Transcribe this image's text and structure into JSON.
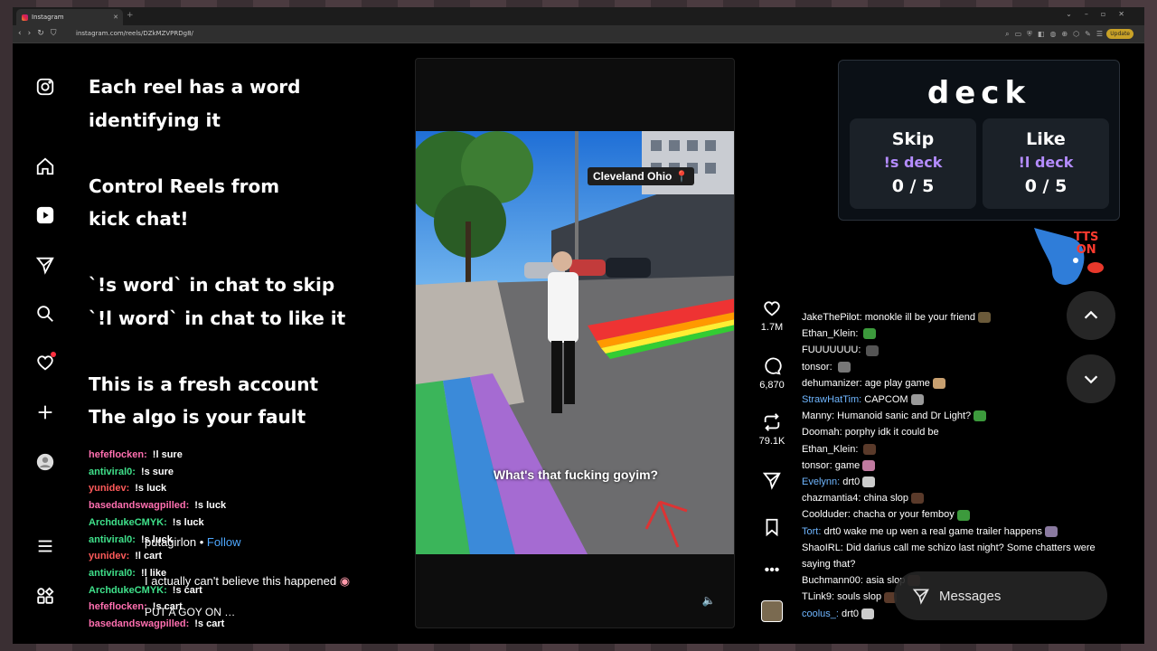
{
  "browser": {
    "tab_title": "Instagram",
    "url": "instagram.com/reels/DZkMZVPRDg8/",
    "update_label": "Update"
  },
  "overlay_text": "Each reel has a word\nidentifying it\n\nControl Reels from\nkick chat!\n\n`!s word` in chat to skip\n`!l word` in chat to like it\n\nThis is a fresh account\nThe algo is your fault",
  "left_chat": [
    {
      "user": "hefeflocken:",
      "msg": "!l sure",
      "color": "#ff6fb0"
    },
    {
      "user": "antiviral0:",
      "msg": "!s sure",
      "color": "#3fe08a"
    },
    {
      "user": "yunidev:",
      "msg": "!s luck",
      "color": "#ff5a5a"
    },
    {
      "user": "basedandswagpilled:",
      "msg": "!s luck",
      "color": "#ff6fb0"
    },
    {
      "user": "ArchdukeCMYK:",
      "msg": "!s luck",
      "color": "#3fe08a"
    },
    {
      "user": "antiviral0:",
      "msg": "!s luck",
      "color": "#3fe08a"
    },
    {
      "user": "yunidev:",
      "msg": "!l cart",
      "color": "#ff5a5a"
    },
    {
      "user": "antiviral0:",
      "msg": "!l like",
      "color": "#3fe08a"
    },
    {
      "user": "ArchdukeCMYK:",
      "msg": "!s cart",
      "color": "#3fe08a"
    },
    {
      "user": "hefeflocken:",
      "msg": "!s cart",
      "color": "#ff6fb0"
    },
    {
      "user": "basedandswagpilled:",
      "msg": "!s cart",
      "color": "#ff6fb0"
    }
  ],
  "reel": {
    "author": "putagirlon",
    "follow_label": "Follow",
    "description": "I actually can't believe this happened",
    "audio": "PUT A GOY ON",
    "location": "Cleveland Ohio",
    "caption": "What's that fucking goyim?"
  },
  "actions": {
    "likes": "1.7M",
    "comments": "6,870",
    "reposts": "79.1K"
  },
  "deck": {
    "title": "deck",
    "skip_label": "Skip",
    "skip_cmd": "!s deck",
    "skip_count": "0 / 5",
    "like_label": "Like",
    "like_cmd": "!l deck",
    "like_count": "0 / 5"
  },
  "tts": {
    "line1": "TTS",
    "line2": "ON"
  },
  "right_chat": [
    {
      "user": "JakeThePilot:",
      "msg": "monokle ill be your friend",
      "color": "#ffffff"
    },
    {
      "user": "Ethan_Klein:",
      "msg": "",
      "color": "#ffffff"
    },
    {
      "user": "FUUUUUUU:",
      "msg": "",
      "color": "#ffffff"
    },
    {
      "user": "tonsor:",
      "msg": "",
      "color": "#ffffff"
    },
    {
      "user": "dehumanizer:",
      "msg": "age play game",
      "color": "#ffffff"
    },
    {
      "user": "StrawHatTim:",
      "msg": "CAPCOM",
      "color": "#6fb6ff"
    },
    {
      "user": "Manny:",
      "msg": "Humanoid sanic and Dr Light?",
      "color": "#ffffff"
    },
    {
      "user": "Doomah:",
      "msg": "porphy idk it could be",
      "color": "#ffffff"
    },
    {
      "user": "Ethan_Klein:",
      "msg": "",
      "color": "#ffffff"
    },
    {
      "user": "tonsor:",
      "msg": "game",
      "color": "#ffffff"
    },
    {
      "user": "Evelynn:",
      "msg": "drt0",
      "color": "#6fb6ff"
    },
    {
      "user": "chazmantia4:",
      "msg": "china slop",
      "color": "#ffffff"
    },
    {
      "user": "Coolduder:",
      "msg": "chacha or your femboy",
      "color": "#ffffff"
    },
    {
      "user": "Tort:",
      "msg": "drt0 wake me up wen a real game trailer happens",
      "color": "#6fb6ff"
    },
    {
      "user": "ShaoIRL:",
      "msg": "Did darius call me schizo last night? Some chatters were saying that?",
      "color": "#ffffff"
    },
    {
      "user": "Buchmann00:",
      "msg": "asia slop",
      "color": "#ffffff"
    },
    {
      "user": "TLink9:",
      "msg": "souls slop",
      "color": "#ffffff"
    },
    {
      "user": "coolus_:",
      "msg": "drt0",
      "color": "#6fb6ff"
    }
  ],
  "messages_label": "Messages"
}
